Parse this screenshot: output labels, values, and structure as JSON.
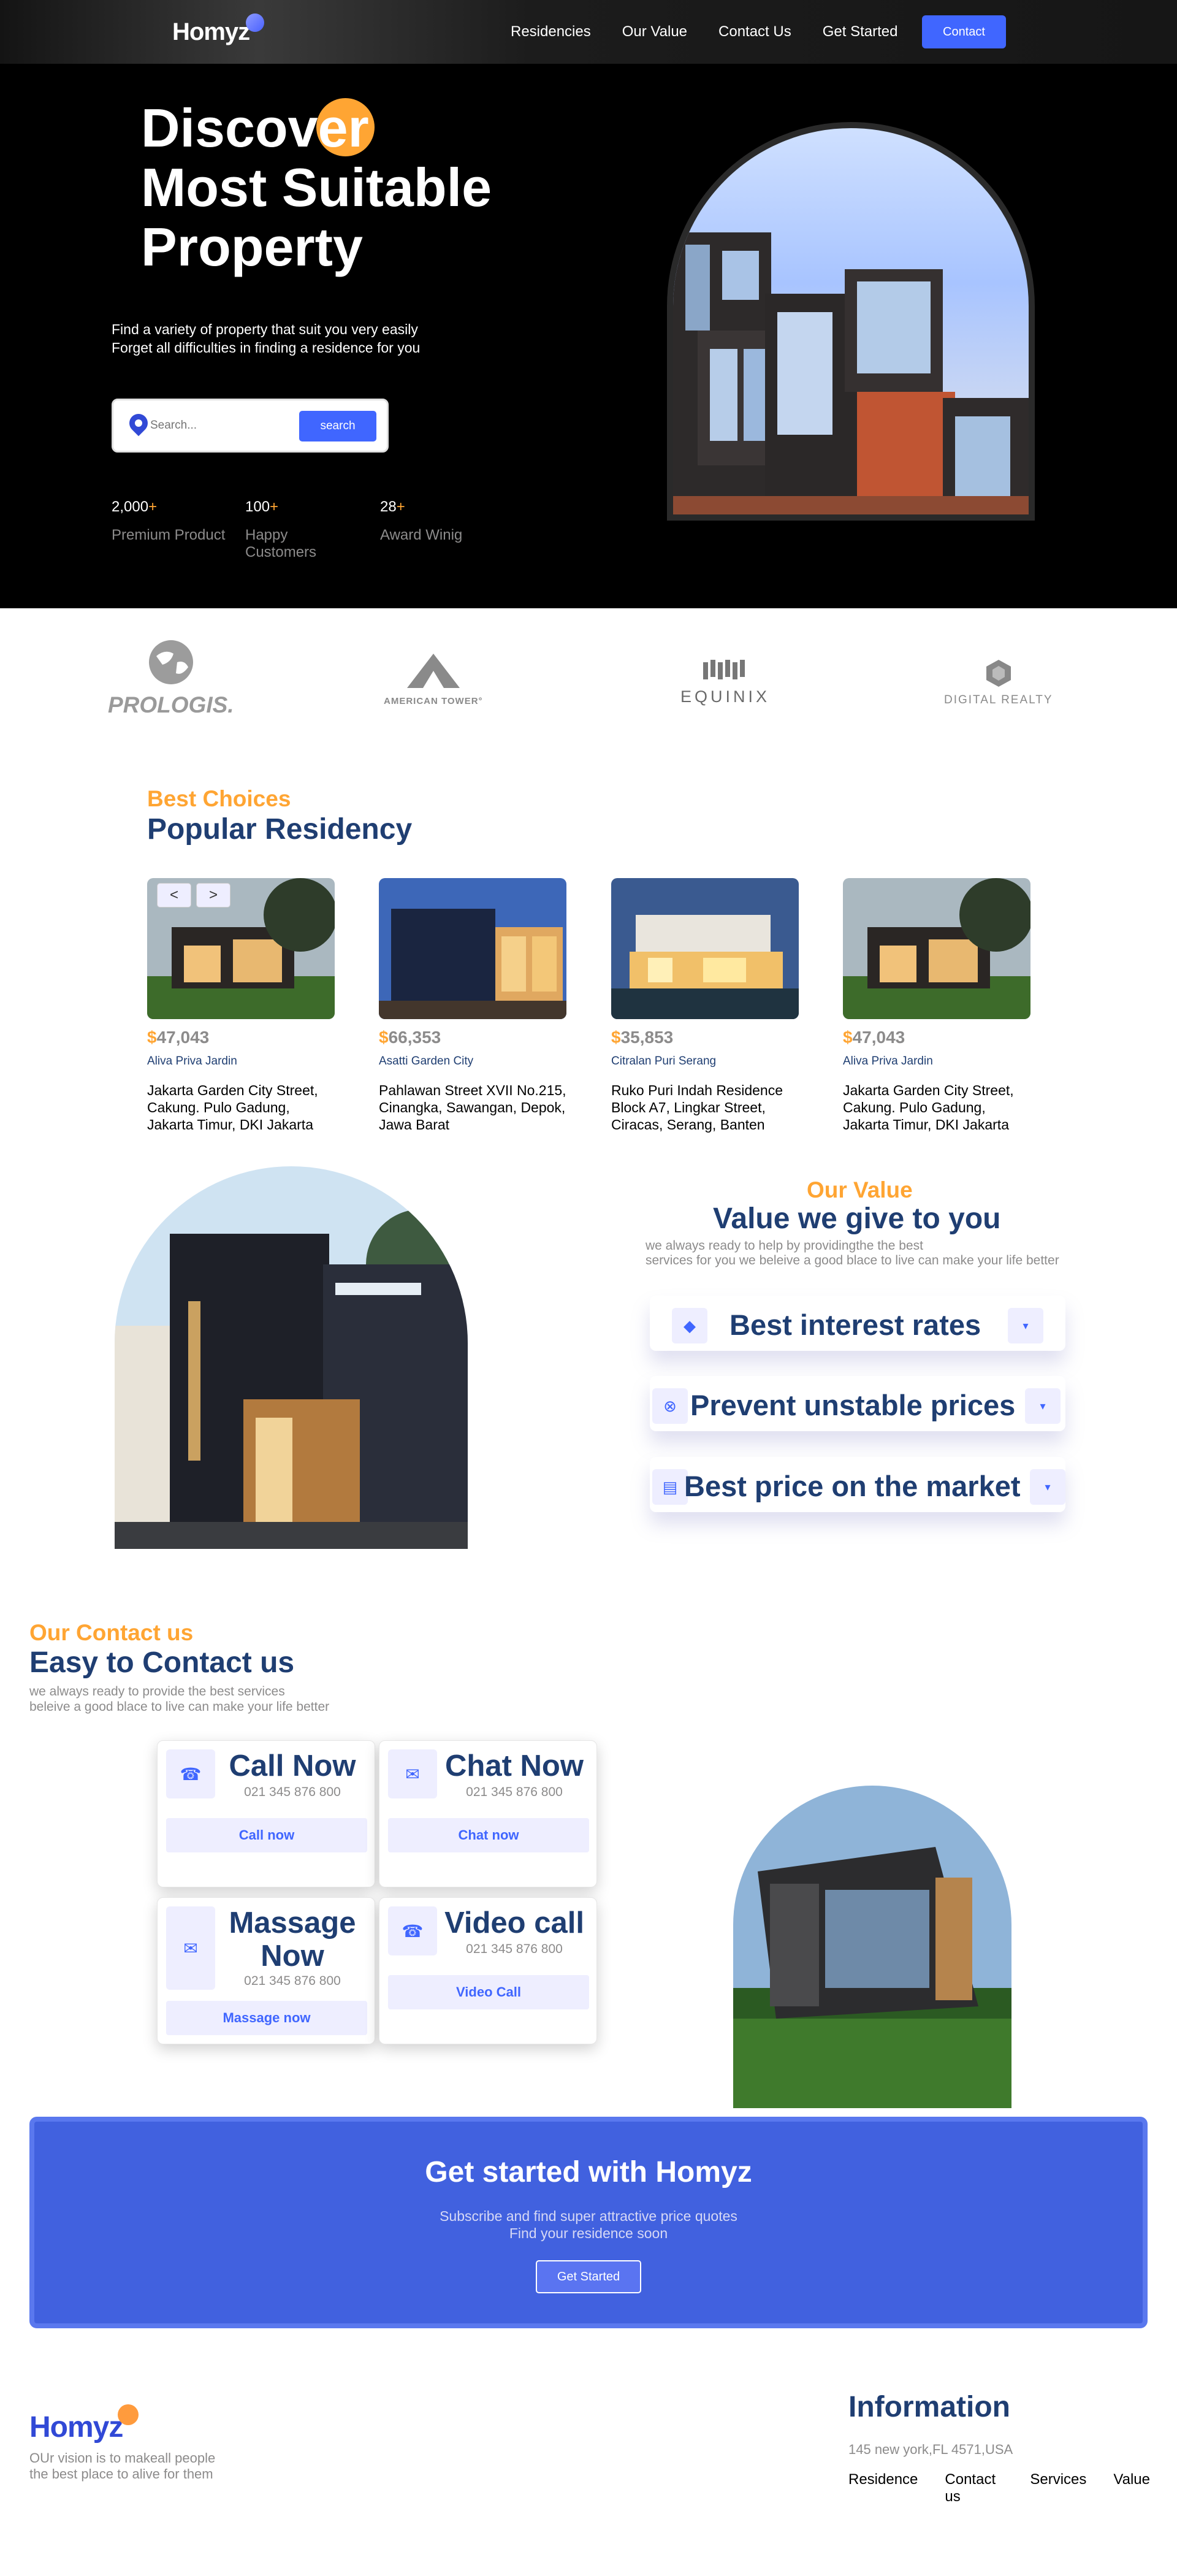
{
  "header": {
    "logo": "Homyz",
    "nav": [
      "Residencies",
      "Our Value",
      "Contact Us",
      "Get Started"
    ],
    "contact_button": "Contact"
  },
  "hero": {
    "title_line1": "Discover",
    "title_line2": "Most Suitable",
    "title_line3": "Property",
    "desc_line1": "Find a variety of property that suit you very easily",
    "desc_line2": "Forget all difficulties in finding a residence for you",
    "search_placeholder": "Search...",
    "search_button": "search",
    "stats": [
      {
        "value": "2,000",
        "plus": "+",
        "label": "Premium Product"
      },
      {
        "value": "100",
        "plus": "+",
        "label": "Happy Customers"
      },
      {
        "value": "28",
        "plus": "+",
        "label": "Award Winig"
      }
    ]
  },
  "companies": [
    {
      "name": "PROLOGIS."
    },
    {
      "name": "AMERICAN TOWER°"
    },
    {
      "name": "EQUINIX"
    },
    {
      "name": "DIGITAL REALTY"
    }
  ],
  "residencies": {
    "subtitle": "Best Choices",
    "title": "Popular Residency",
    "prev_button": "<",
    "next_button": ">",
    "cards": [
      {
        "currency": "$",
        "price": "47,043",
        "name": "Aliva Priva Jardin",
        "detail": "Jakarta Garden City Street, Cakung. Pulo Gadung, Jakarta Timur, DKI Jakarta"
      },
      {
        "currency": "$",
        "price": "66,353",
        "name": "Asatti Garden City",
        "detail": "Pahlawan Street XVII No.215, Cinangka, Sawangan, Depok, Jawa Barat"
      },
      {
        "currency": "$",
        "price": "35,853",
        "name": "Citralan Puri Serang",
        "detail": "Ruko Puri Indah Residence Block A7, Lingkar Street, Ciracas, Serang, Banten"
      },
      {
        "currency": "$",
        "price": "47,043",
        "name": "Aliva Priva Jardin",
        "detail": "Jakarta Garden City Street, Cakung. Pulo Gadung, Jakarta Timur, DKI Jakarta"
      }
    ]
  },
  "value": {
    "subtitle": "Our Value",
    "title": "Value we give to you",
    "desc_line1": "we always ready to help by providingthe the best",
    "desc_line2": "services for you we beleive a good blace to live can make your life better",
    "items": [
      {
        "title": "Best interest rates",
        "icon": "shield-check-icon"
      },
      {
        "title": "Prevent unstable prices",
        "icon": "x-circle-icon"
      },
      {
        "title": "Best price on the market",
        "icon": "chart-icon"
      }
    ]
  },
  "contact": {
    "subtitle": "Our Contact us",
    "title": "Easy to Contact us",
    "desc_line1": "we always ready to provide the best services",
    "desc_line2": "beleive a good blace to live can make your life better",
    "cards": [
      {
        "title": "Call Now",
        "number": "021 345 876 800",
        "button": "Call now",
        "icon": "phone-icon"
      },
      {
        "title": "Chat Now",
        "number": "021 345 876 800",
        "button": "Chat now",
        "icon": "chat-icon"
      },
      {
        "title": "Massage Now",
        "number": "021 345 876 800",
        "button": "Massage now",
        "icon": "message-icon"
      },
      {
        "title": "Video call",
        "number": "021 345 876 800",
        "button": "Video Call",
        "icon": "video-phone-icon"
      }
    ]
  },
  "cta": {
    "title": "Get started with Homyz",
    "sub_line1": "Subscribe and find super attractive price quotes",
    "sub_line2": "Find your residence soon",
    "button": "Get Started"
  },
  "footer": {
    "logo": "Homyz",
    "vision_line1": "OUr vision is to makeall people",
    "vision_line2": "the best place to alive for them",
    "info_title": "Information",
    "address": "145 new york,FL 4571,USA",
    "links": [
      "Residence",
      "Contact us",
      "Services",
      "Value"
    ]
  },
  "colors": {
    "brand_blue": "#4066ff",
    "accent_orange": "#ffa533",
    "title_navy": "#1f3e72",
    "cta_bg": "#4161df"
  }
}
